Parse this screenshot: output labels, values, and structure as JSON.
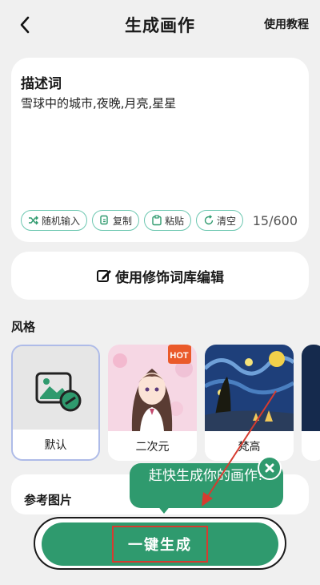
{
  "header": {
    "title": "生成画作",
    "tutorial_label": "使用教程"
  },
  "description": {
    "label": "描述词",
    "text": "雪球中的城市,夜晚,月亮,星星",
    "counter": "15/600",
    "tools": [
      {
        "label": "随机输入",
        "icon": "shuffle-icon"
      },
      {
        "label": "复制",
        "icon": "copy-icon"
      },
      {
        "label": "粘贴",
        "icon": "paste-icon"
      },
      {
        "label": "清空",
        "icon": "refresh-icon"
      }
    ]
  },
  "modifier": {
    "label": "使用修饰词库编辑",
    "icon": "edit-icon"
  },
  "styles": {
    "label": "风格",
    "items": [
      {
        "label": "默认",
        "selected": true
      },
      {
        "label": "二次元",
        "badge": "HOT"
      },
      {
        "label": "梵高"
      }
    ]
  },
  "reference": {
    "label": "参考图片"
  },
  "tooltip": {
    "text": "赶快生成你的画作!"
  },
  "generate": {
    "label": "一键生成"
  },
  "colors": {
    "accent": "#2f9a6e",
    "highlight": "#d63b2f",
    "outline": "#6cc7b0"
  }
}
